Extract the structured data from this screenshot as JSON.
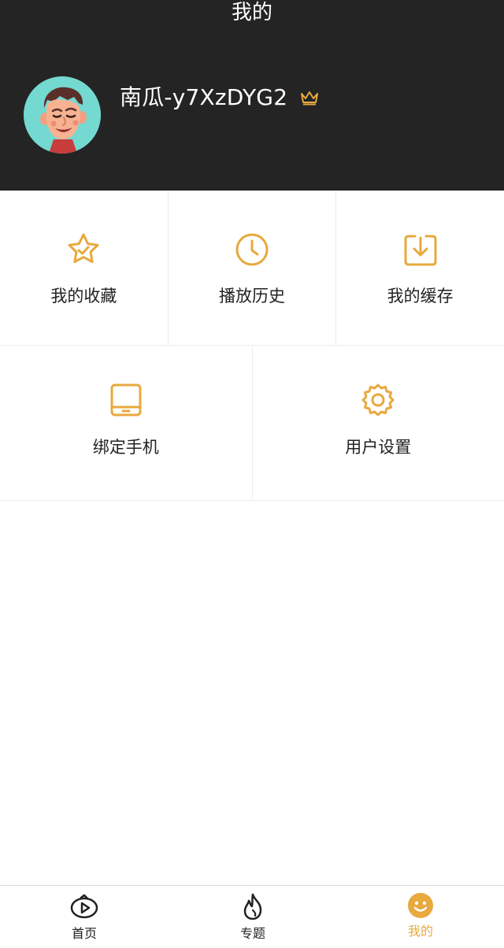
{
  "header": {
    "title": "我的",
    "username": "南瓜-y7XzDYG2"
  },
  "menu": {
    "row1": [
      {
        "label": "我的收藏",
        "icon": "star-icon"
      },
      {
        "label": "播放历史",
        "icon": "clock-icon"
      },
      {
        "label": "我的缓存",
        "icon": "download-icon"
      }
    ],
    "row2": [
      {
        "label": "绑定手机",
        "icon": "tablet-icon"
      },
      {
        "label": "用户设置",
        "icon": "gear-icon"
      }
    ]
  },
  "tabbar": {
    "tabs": [
      {
        "label": "首页",
        "icon": "play-icon"
      },
      {
        "label": "专题",
        "icon": "flame-icon"
      },
      {
        "label": "我的",
        "icon": "smiley-icon",
        "active": true
      }
    ]
  },
  "colors": {
    "accent": "#e8a93d",
    "header_bg": "#242424",
    "avatar_bg": "#74d9d0"
  }
}
